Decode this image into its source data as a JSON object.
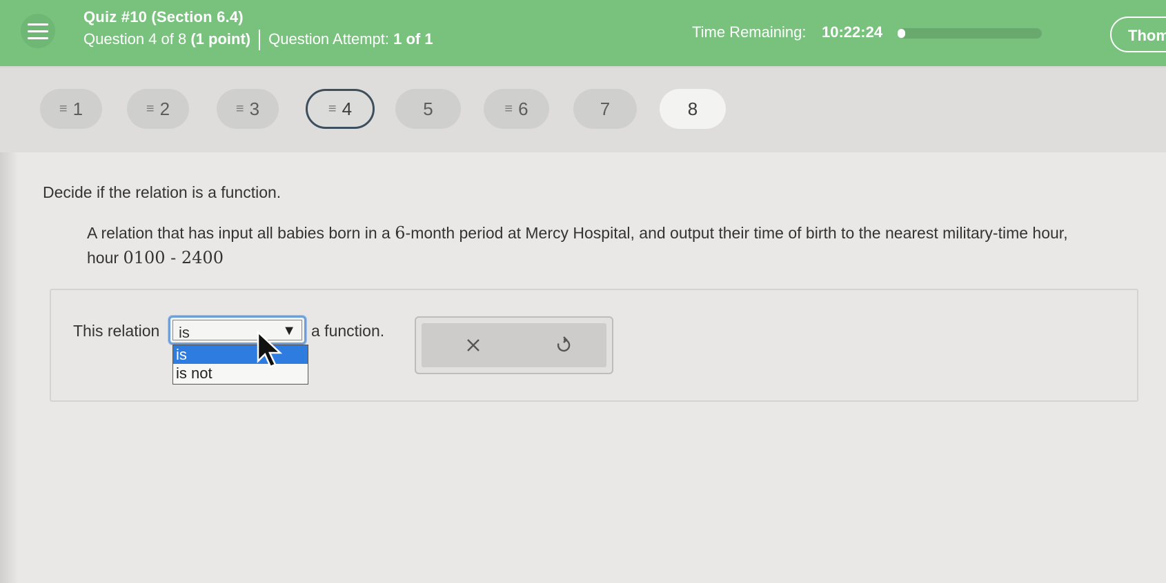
{
  "header": {
    "quiz_title": "Quiz #10 (Section 6.4)",
    "question_of": "Question 4 of 8",
    "points": "(1 point)",
    "attempt_label": "Question Attempt:",
    "attempt_value": "1 of 1",
    "time_label": "Time Remaining:",
    "time_value": "10:22:24",
    "time_progress_fraction": 0.02,
    "user_name": "Thom",
    "accent_color": "#79c27e"
  },
  "question_nav": [
    {
      "number": "1",
      "answered": true
    },
    {
      "number": "2",
      "answered": true
    },
    {
      "number": "3",
      "answered": true
    },
    {
      "number": "4",
      "answered": true,
      "current": true
    },
    {
      "number": "5",
      "answered": false
    },
    {
      "number": "6",
      "answered": true
    },
    {
      "number": "7",
      "answered": false
    },
    {
      "number": "8",
      "answered": false
    }
  ],
  "question": {
    "prompt": "Decide if the relation is a function.",
    "relation_text_before": "A relation that has input all babies born in a ",
    "relation_math_1": "6",
    "relation_text_middle": "-month period at Mercy Hospital, and output their time of birth to the nearest military-time hour, hour ",
    "relation_math_2": "0100 - 2400"
  },
  "answer": {
    "lead_text": "This relation",
    "select_value": "is",
    "options": [
      "is",
      "is not"
    ],
    "highlighted_option": "is",
    "trail_text": "a function."
  },
  "tools": {
    "clear_icon": "close-icon",
    "undo_icon": "undo-icon"
  }
}
